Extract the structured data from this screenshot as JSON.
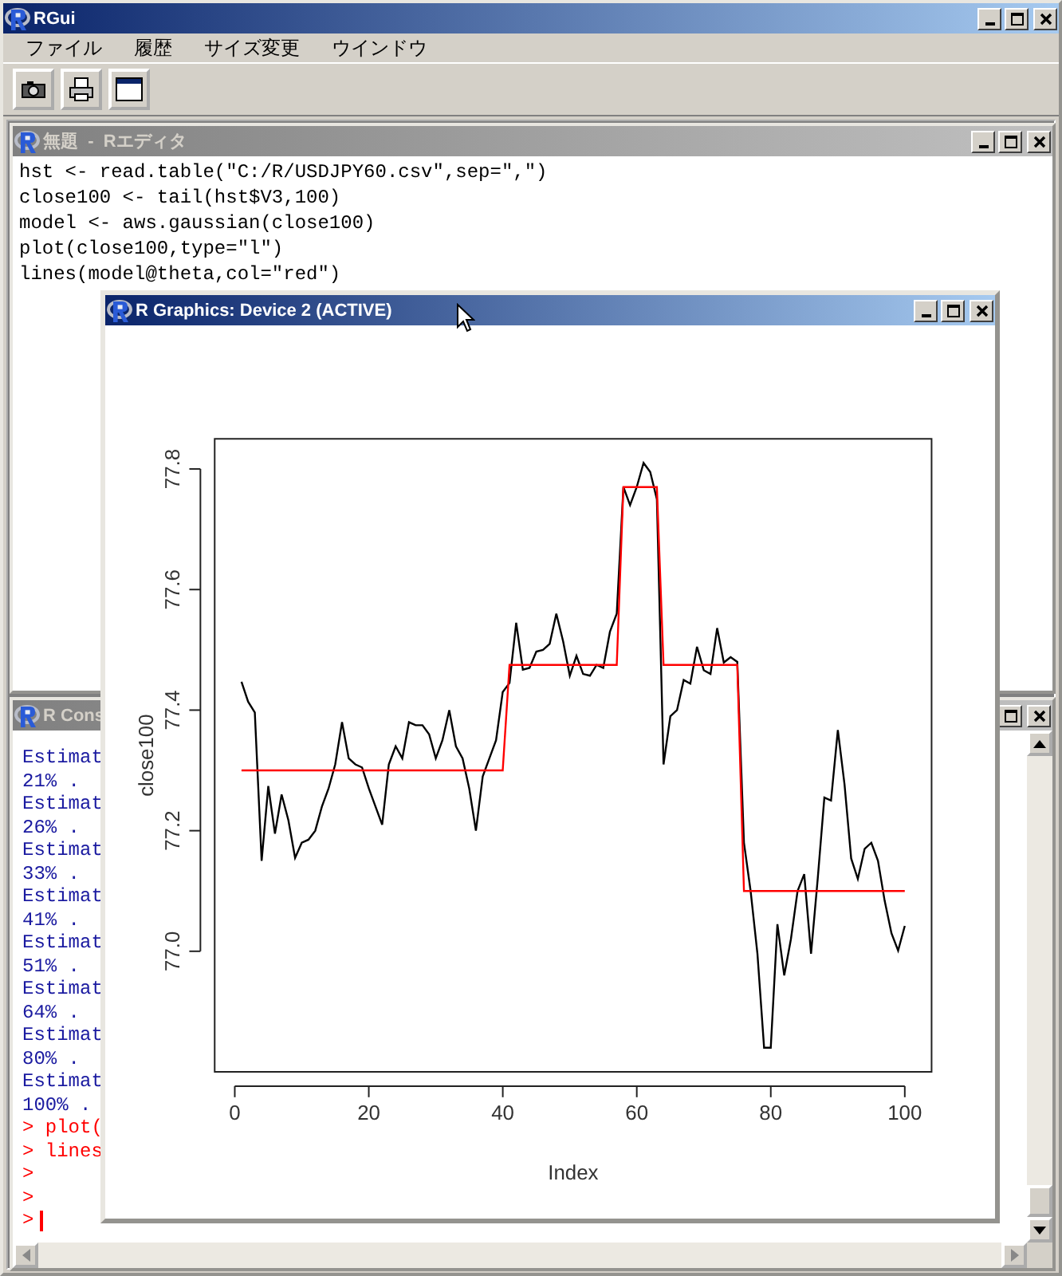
{
  "window": {
    "title": "RGui",
    "active": true
  },
  "menu": [
    "ファイル",
    "履歴",
    "サイズ変更",
    "ウインドウ"
  ],
  "editor": {
    "title": "無題  -  Rエディタ",
    "active": false,
    "lines": [
      "hst <- read.table(\"C:/R/USDJPY60.csv\",sep=\",\")",
      "close100 <- tail(hst$V3,100)",
      "model <- aws.gaussian(close100)",
      "plot(close100,type=\"l\")",
      "lines(model@theta,col=\"red\")"
    ]
  },
  "console": {
    "title": "R Cons",
    "active": false,
    "lines": [
      {
        "text": "Estimat",
        "kind": "output"
      },
      {
        "text": "21% .",
        "kind": "output"
      },
      {
        "text": "Estimat",
        "kind": "output"
      },
      {
        "text": "26% .",
        "kind": "output"
      },
      {
        "text": "Estimat",
        "kind": "output"
      },
      {
        "text": "33% .",
        "kind": "output"
      },
      {
        "text": "Estimat",
        "kind": "output"
      },
      {
        "text": "41% .",
        "kind": "output"
      },
      {
        "text": "Estimat",
        "kind": "output"
      },
      {
        "text": "51% .",
        "kind": "output"
      },
      {
        "text": "Estimat",
        "kind": "output"
      },
      {
        "text": "64% .",
        "kind": "output"
      },
      {
        "text": "Estimat",
        "kind": "output"
      },
      {
        "text": "80% .",
        "kind": "output"
      },
      {
        "text": "Estimat",
        "kind": "output"
      },
      {
        "text": "100% .",
        "kind": "output"
      },
      {
        "text": "> plot(",
        "kind": "input"
      },
      {
        "text": "> lines",
        "kind": "input"
      },
      {
        "text": ">",
        "kind": "input"
      },
      {
        "text": ">",
        "kind": "input"
      },
      {
        "text": ">",
        "kind": "prompt"
      }
    ]
  },
  "graphics": {
    "title": "R Graphics: Device 2 (ACTIVE)",
    "active": true,
    "chart_data": {
      "type": "line",
      "xlabel": "Index",
      "ylabel": "close100",
      "x": [
        1,
        2,
        3,
        4,
        5,
        6,
        7,
        8,
        9,
        10,
        11,
        12,
        13,
        14,
        15,
        16,
        17,
        18,
        19,
        20,
        21,
        22,
        23,
        24,
        25,
        26,
        27,
        28,
        29,
        30,
        31,
        32,
        33,
        34,
        35,
        36,
        37,
        38,
        39,
        40,
        41,
        42,
        43,
        44,
        45,
        46,
        47,
        48,
        49,
        50,
        51,
        52,
        53,
        54,
        55,
        56,
        57,
        58,
        59,
        60,
        61,
        62,
        63,
        64,
        65,
        66,
        67,
        68,
        69,
        70,
        71,
        72,
        73,
        74,
        75,
        76,
        77,
        78,
        79,
        80,
        81,
        82,
        83,
        84,
        85,
        86,
        87,
        88,
        89,
        90,
        91,
        92,
        93,
        94,
        95,
        96,
        97,
        98,
        99,
        100
      ],
      "series": [
        {
          "color": "#000000",
          "values": [
            77.447,
            77.414,
            77.396,
            77.15,
            77.274,
            77.195,
            77.26,
            77.217,
            77.155,
            77.18,
            77.185,
            77.2,
            77.24,
            77.27,
            77.31,
            77.38,
            77.32,
            77.31,
            77.305,
            77.27,
            77.24,
            77.21,
            77.31,
            77.34,
            77.32,
            77.38,
            77.375,
            77.375,
            77.36,
            77.32,
            77.35,
            77.4,
            77.34,
            77.32,
            77.27,
            77.2,
            77.29,
            77.32,
            77.35,
            77.43,
            77.445,
            77.545,
            77.467,
            77.47,
            77.497,
            77.5,
            77.51,
            77.56,
            77.514,
            77.457,
            77.49,
            77.46,
            77.457,
            77.475,
            77.47,
            77.53,
            77.56,
            77.77,
            77.74,
            77.77,
            77.81,
            77.795,
            77.75,
            77.31,
            77.39,
            77.4,
            77.45,
            77.444,
            77.505,
            77.466,
            77.46,
            77.536,
            77.479,
            77.488,
            77.48,
            77.18,
            77.1,
            76.996,
            76.84,
            76.84,
            77.045,
            76.96,
            77.02,
            77.1,
            77.128,
            76.996,
            77.12,
            77.255,
            77.25,
            77.367,
            77.277,
            77.154,
            77.12,
            77.17,
            77.18,
            77.15,
            77.084,
            77.03,
            77.001,
            77.042
          ]
        },
        {
          "color": "#ff0000",
          "values": [
            77.3,
            77.3,
            77.3,
            77.3,
            77.3,
            77.3,
            77.3,
            77.3,
            77.3,
            77.3,
            77.3,
            77.3,
            77.3,
            77.3,
            77.3,
            77.3,
            77.3,
            77.3,
            77.3,
            77.3,
            77.3,
            77.3,
            77.3,
            77.3,
            77.3,
            77.3,
            77.3,
            77.3,
            77.3,
            77.3,
            77.3,
            77.3,
            77.3,
            77.3,
            77.3,
            77.3,
            77.3,
            77.3,
            77.3,
            77.3,
            77.475,
            77.475,
            77.475,
            77.475,
            77.475,
            77.475,
            77.475,
            77.475,
            77.475,
            77.475,
            77.475,
            77.475,
            77.475,
            77.475,
            77.475,
            77.475,
            77.475,
            77.77,
            77.77,
            77.77,
            77.77,
            77.77,
            77.77,
            77.475,
            77.475,
            77.475,
            77.475,
            77.475,
            77.475,
            77.475,
            77.475,
            77.475,
            77.475,
            77.475,
            77.475,
            77.1,
            77.1,
            77.1,
            77.1,
            77.1,
            77.1,
            77.1,
            77.1,
            77.1,
            77.1,
            77.1,
            77.1,
            77.1,
            77.1,
            77.1,
            77.1,
            77.1,
            77.1,
            77.1,
            77.1,
            77.1,
            77.1,
            77.1,
            77.1,
            77.1
          ]
        }
      ],
      "xlim": [
        -3,
        104
      ],
      "ylim": [
        76.8,
        77.85
      ],
      "xticks": [
        0,
        20,
        40,
        60,
        80,
        100
      ],
      "yticks": [
        {
          "value": 77.0,
          "label": "77.0"
        },
        {
          "value": 77.2,
          "label": "77.2"
        },
        {
          "value": 77.4,
          "label": "77.4"
        },
        {
          "value": 77.6,
          "label": "77.6"
        },
        {
          "value": 77.8,
          "label": "77.8"
        }
      ]
    }
  }
}
